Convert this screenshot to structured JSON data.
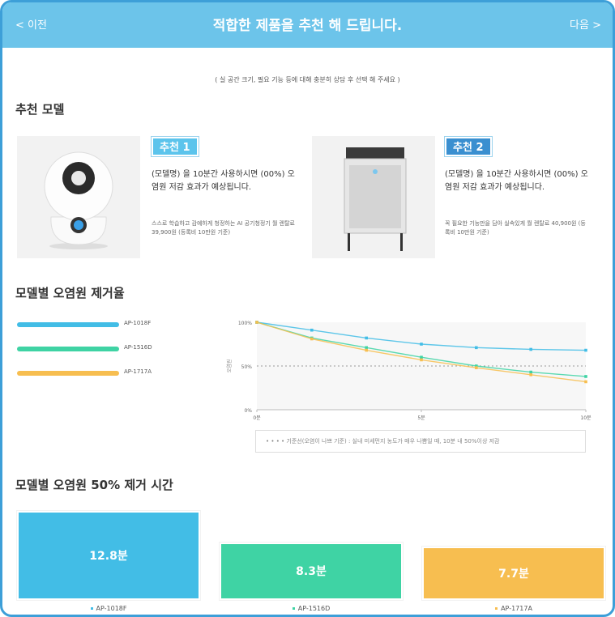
{
  "header": {
    "prev_label": "< 이전",
    "title": "적합한 제품을 추천 해 드립니다.",
    "next_label": "다음 >"
  },
  "notice": "( 실 공간 크기, 필요 기능 등에 대해 충분히 상담 후 선택 해 주세요 )",
  "recommend": {
    "section_title": "추천 모델",
    "products": [
      {
        "badge": "추천 1",
        "desc": "(모델명) 을 10분간 사용하시면 (00%) 오염원 저감 효과가 예상됩니다.",
        "note": "스스로 학습하고 감예하게 청정하는 AI 공기청정기 월 렌탈료 39,900원 (등록비 10만원 기준)",
        "image_icon": "round-air-purifier-icon"
      },
      {
        "badge": "추천 2",
        "desc": "(모델명) 을 10분간 사용하시면 (00%) 오염원 저감 효과가 예상됩니다.",
        "note": "꼭 필요한 기능만을 담아 실속있게 월 렌탈료 40,900원 (등록비 10만원 기준)",
        "image_icon": "tower-air-purifier-icon"
      }
    ]
  },
  "removal": {
    "section_title": "모델별 오염원 제거율",
    "caption": "• • • •  기준선(오염이 나쁘 기준) : 실내 미세먼지 농도가 매우 나쁨일 때, 10분 내 50%이상 저감",
    "colors": {
      "AP-1018F": "#42bde6",
      "AP-1516D": "#3fd3a4",
      "AP-1717A": "#f7be50"
    }
  },
  "chart_data": [
    {
      "type": "line",
      "title": "",
      "ylabel": "오염원",
      "xlabel": "",
      "x": [
        0,
        1.67,
        3.33,
        5,
        6.67,
        8.33,
        10
      ],
      "x_ticks": [
        "0분",
        "5분",
        "10분"
      ],
      "x_tick_values": [
        0,
        5,
        10
      ],
      "y_ticks": [
        "100%",
        "50%",
        "0%"
      ],
      "y_tick_values": [
        100,
        50,
        0
      ],
      "ylim": [
        0,
        100
      ],
      "xlim": [
        0,
        10
      ],
      "reference_line": 50,
      "legend_position": "left",
      "series": [
        {
          "name": "AP-1018F",
          "values": [
            100,
            91,
            82,
            75,
            71,
            69,
            68
          ]
        },
        {
          "name": "AP-1516D",
          "values": [
            100,
            82,
            71,
            60,
            50,
            43,
            38
          ]
        },
        {
          "name": "AP-1717A",
          "values": [
            100,
            81,
            68,
            57,
            48,
            40,
            32
          ]
        }
      ]
    },
    {
      "type": "bar",
      "title": "모델별 오염원 50% 제거 시간",
      "categories": [
        "AP-1018F",
        "AP-1516D",
        "AP-1717A"
      ],
      "values": [
        12.8,
        8.3,
        7.7
      ],
      "value_labels": [
        "12.8분",
        "8.3분",
        "7.7분"
      ],
      "unit": "분",
      "ylim": [
        0,
        12.8
      ]
    }
  ]
}
